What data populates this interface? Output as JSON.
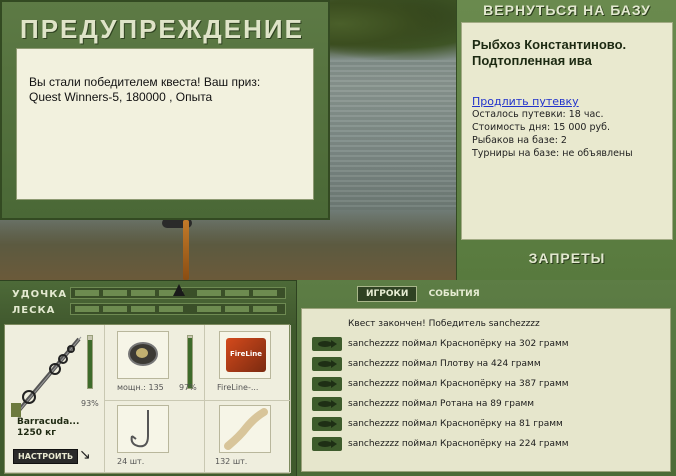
{
  "dialog": {
    "title": "ПРЕДУПРЕЖДЕНИЕ",
    "message_line1": "Вы стали победителем квеста! Ваш приз:",
    "message_line2": "Quest Winners-5, 180000 , Опыта"
  },
  "right_panel": {
    "return_label": "ВЕРНУТЬСЯ НА БАЗУ",
    "place_name_line1": "Рыбхоз Константиново.",
    "place_name_line2": "Подтопленная ива",
    "extend_link": "Продлить путевку",
    "rows": [
      "Осталось путевки: 18 час.",
      "Стоимость дня: 15 000 руб.",
      "Рыбаков на базе: 2",
      "Турниры на базе: не объявлены"
    ],
    "bans_label": "ЗАПРЕТЫ"
  },
  "gear": {
    "rod_label": "УДОЧКА",
    "line_label": "ЛЕСКА",
    "rod_name": "Barracuda...",
    "rod_weight": "1250 кг",
    "rod_condition": "93%",
    "reel_power": "мощн.: 135",
    "reel_condition": "97%",
    "line_name": "FireLine-...",
    "hook_count": "24 шт.",
    "bait_count": "132 шт.",
    "setup_label": "НАСТРОИТЬ",
    "levels": {
      "rod_meter": 0.93,
      "reel_meter": 0.97
    }
  },
  "events": {
    "tab_players": "ИГРОКИ",
    "tab_events": "СОБЫТИЯ",
    "header": "Квест закончен! Победитель sanchezzzz",
    "items": [
      "sanchezzzz поймал Краснопёрку на 302 грамм",
      "sanchezzzz поймал Плотву на 424 грамм",
      "sanchezzzz поймал Краснопёрку на 387 грамм",
      "sanchezzzz поймал Ротана на 89 грамм",
      "sanchezzzz поймал Краснопёрку на 81 грамм",
      "sanchezzzz поймал Краснопёрку на 224 грамм"
    ]
  }
}
